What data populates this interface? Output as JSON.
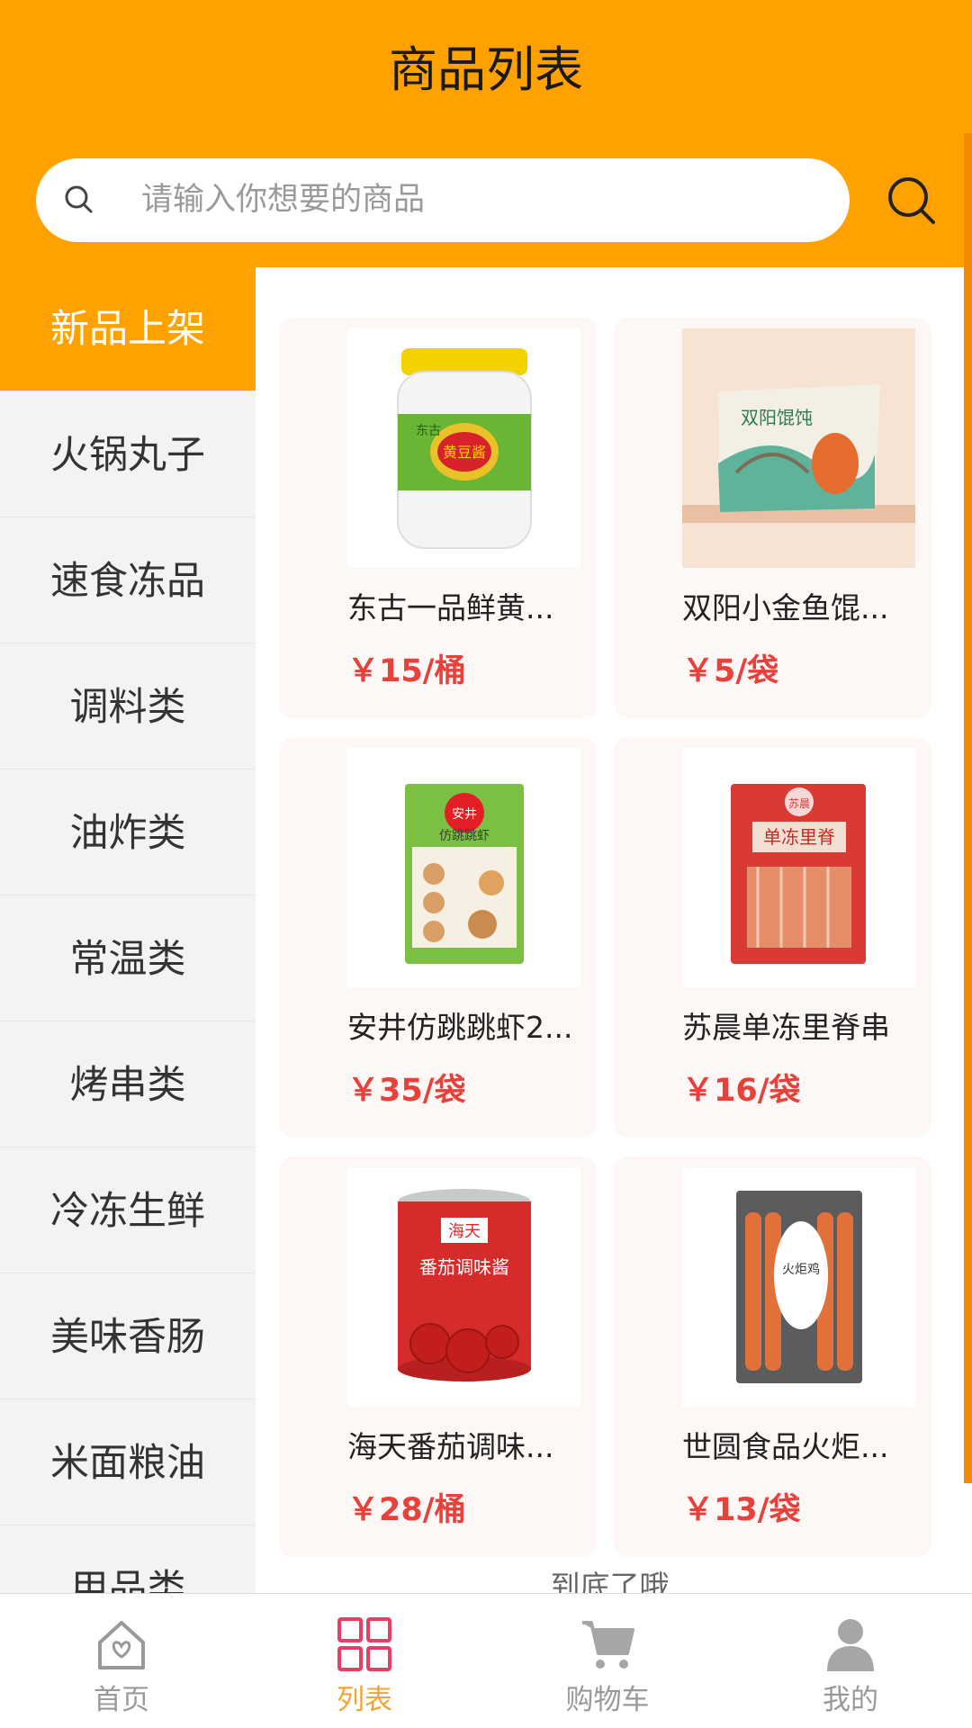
{
  "header": {
    "title": "商品列表",
    "search_placeholder": "请输入你想要的商品"
  },
  "sidebar": {
    "items": [
      {
        "label": "新品上架",
        "active": true
      },
      {
        "label": "火锅丸子",
        "active": false
      },
      {
        "label": "速食冻品",
        "active": false
      },
      {
        "label": "调料类",
        "active": false
      },
      {
        "label": "油炸类",
        "active": false
      },
      {
        "label": "常温类",
        "active": false
      },
      {
        "label": "烤串类",
        "active": false
      },
      {
        "label": "冷冻生鲜",
        "active": false
      },
      {
        "label": "美味香肠",
        "active": false
      },
      {
        "label": "米面粮油",
        "active": false
      },
      {
        "label": "用品类",
        "active": false
      }
    ]
  },
  "products": [
    {
      "name": "东古一品鲜黄...",
      "price": "￥15/桶"
    },
    {
      "name": "双阳小金鱼馄...",
      "price": "￥5/袋"
    },
    {
      "name": "安井仿跳跳虾2...",
      "price": "￥35/袋"
    },
    {
      "name": "苏晨单冻里脊串",
      "price": "￥16/袋"
    },
    {
      "name": "海天番茄调味...",
      "price": "￥28/桶"
    },
    {
      "name": "世圆食品火炬...",
      "price": "￥13/袋"
    }
  ],
  "product_images": {
    "p0": {
      "brand": "东古",
      "label": "黄豆酱"
    },
    "p1": {
      "label": "双阳馄饨"
    },
    "p2": {
      "brand": "安井",
      "label": "仿跳跳虾"
    },
    "p3": {
      "brand": "苏晨",
      "label": "单冻里脊"
    },
    "p4": {
      "brand": "海天",
      "label": "番茄调味酱"
    },
    "p5": {
      "label": "火炬鸡"
    }
  },
  "end_text": "到底了哦",
  "tabbar": {
    "items": [
      {
        "label": "首页",
        "icon": "home-icon",
        "active": false
      },
      {
        "label": "列表",
        "icon": "grid-icon",
        "active": true
      },
      {
        "label": "购物车",
        "icon": "cart-icon",
        "active": false
      },
      {
        "label": "我的",
        "icon": "user-icon",
        "active": false
      }
    ]
  },
  "colors": {
    "accent": "#FFA200",
    "price": "#E8403A",
    "tab_active": "#F4A335",
    "tab_inactive": "#999999"
  }
}
